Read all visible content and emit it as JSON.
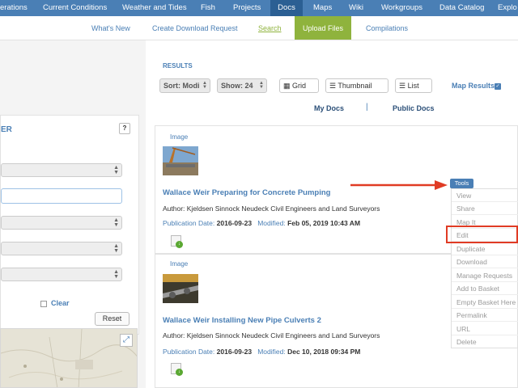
{
  "topnav": {
    "items": [
      {
        "label": "erations"
      },
      {
        "label": "Current Conditions"
      },
      {
        "label": "Weather and Tides"
      },
      {
        "label": "Fish"
      },
      {
        "label": "Projects"
      },
      {
        "label": "Docs"
      },
      {
        "label": "Maps"
      },
      {
        "label": "Wiki"
      },
      {
        "label": "Workgroups"
      },
      {
        "label": "Data Catalog"
      },
      {
        "label": "Explo"
      }
    ]
  },
  "subnav": {
    "items": [
      {
        "label": "What's New"
      },
      {
        "label": "Create Download Request"
      },
      {
        "label": "Search"
      },
      {
        "label": "Upload Files"
      },
      {
        "label": "Compilations"
      }
    ]
  },
  "filter": {
    "title": "ER",
    "help": "?",
    "clear": "Clear",
    "reset": "Reset"
  },
  "map": {
    "expand_icon": "expand-icon"
  },
  "results": {
    "label": "RESULTS",
    "sort": "Sort: Modi",
    "show": "Show: 24",
    "grid": "Grid",
    "thumbnail": "Thumbnail",
    "list": "List",
    "map_results": "Map Results",
    "my_docs": "My Docs",
    "separator": "|",
    "public_docs": "Public Docs"
  },
  "cards": [
    {
      "type": "Image",
      "title": "Wallace Weir Preparing for Concrete Pumping",
      "author": "Author: Kjeldsen Sinnock Neudeck Civil Engineers and Land Surveyors",
      "pub_label": "Publication Date:",
      "pub_date": "2016-09-23",
      "mod_label": "Modified:",
      "mod_date": "Feb 05, 2019 10:43 AM"
    },
    {
      "type": "Image",
      "title": "Wallace Weir Installing New Pipe Culverts 2",
      "author": "Author: Kjeldsen Sinnock Neudeck Civil Engineers and Land Surveyors",
      "pub_label": "Publication Date:",
      "pub_date": "2016-09-23",
      "mod_label": "Modified:",
      "mod_date": "Dec 10, 2018 09:34 PM"
    }
  ],
  "tools": {
    "button": "Tools",
    "menu": [
      "View",
      "Share",
      "Map It",
      "Edit",
      "Duplicate",
      "Download",
      "Manage Requests",
      "Add to Basket",
      "Empty Basket Here",
      "Permalink",
      "URL",
      "Delete"
    ]
  },
  "colors": {
    "nav_blue": "#4a7fb5",
    "nav_active": "#2b5f93",
    "green": "#8fb33d",
    "highlight_red": "#e03b24"
  }
}
